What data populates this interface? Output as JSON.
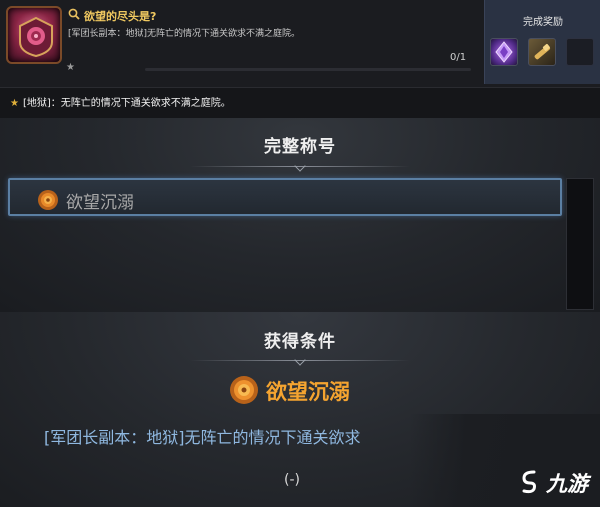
{
  "achievement": {
    "title": "欲望的尽头是?",
    "description": "[军团长副本：地狱]无阵亡的情况下通关欲求不满之庭院。",
    "progress_text": "0/1",
    "progress_fraction": 0
  },
  "reward": {
    "title": "完成奖励",
    "slots": [
      "purple-crystal-icon",
      "golden-telescope-icon",
      "empty-slot"
    ]
  },
  "hell_condition": "[地狱]：无阵亡的情况下通关欲求不满之庭院。",
  "title_section": {
    "heading": "完整称号",
    "selected_title": "欲望沉溺"
  },
  "condition_section": {
    "heading": "获得条件",
    "title_name": "欲望沉溺",
    "description": "[军团长副本：地狱]无阵亡的情况下通关欲求",
    "status": "(-)"
  },
  "watermark": {
    "text": "九游"
  },
  "colors": {
    "accent_gold": "#f5a430",
    "selection_border": "#5b7fa3",
    "condition_blue": "#8fb8e0",
    "reward_panel": "#2a3243"
  }
}
